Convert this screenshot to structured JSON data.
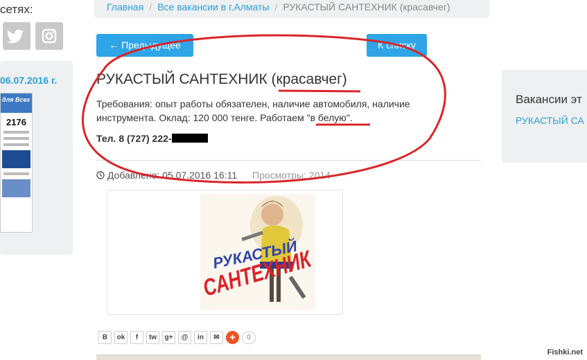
{
  "sidebar": {
    "social_title": "сетях:",
    "social_icons": [
      "twitter-icon",
      "instagram-icon"
    ],
    "date": "06.07.2016 г.",
    "newspaper": {
      "header": "для Всех",
      "number": "2176"
    }
  },
  "breadcrumb": {
    "home": "Главная",
    "vacancies": "Все вакансии в г.Алматы",
    "current": "РУКАСТЫЙ САНТЕХНИК (красавчег)"
  },
  "nav": {
    "prev": "← Предыдущее",
    "list": "К списку"
  },
  "job": {
    "title": "РУКАСТЫЙ САНТЕХНИК (красавчег)",
    "description": "Требования: опыт работы обязателен, наличие автомобиля, наличие инструмента. Оклад: 120 000 тенге. Работаем \"в белую\".",
    "phone": "Тел. 8 (727) 222-",
    "added": "Добавлено: 05.07.2016 16:11",
    "views": "Просмотры: 2014"
  },
  "poster": {
    "line1": "РУКАСТЫЙ",
    "line2": "САНТЕХНИК"
  },
  "share": {
    "buttons": [
      "B",
      "ok",
      "f",
      "tw",
      "g+",
      "@",
      "in",
      "✉"
    ],
    "count": "0"
  },
  "right_panel": {
    "title": "Вакансии эт",
    "link": "РУКАСТЫЙ СА (красавчег)"
  },
  "watermark": "Fishki.net",
  "colors": {
    "accent": "#2fa4e7",
    "link": "#2a9fd6",
    "annotation": "#d9252a"
  }
}
